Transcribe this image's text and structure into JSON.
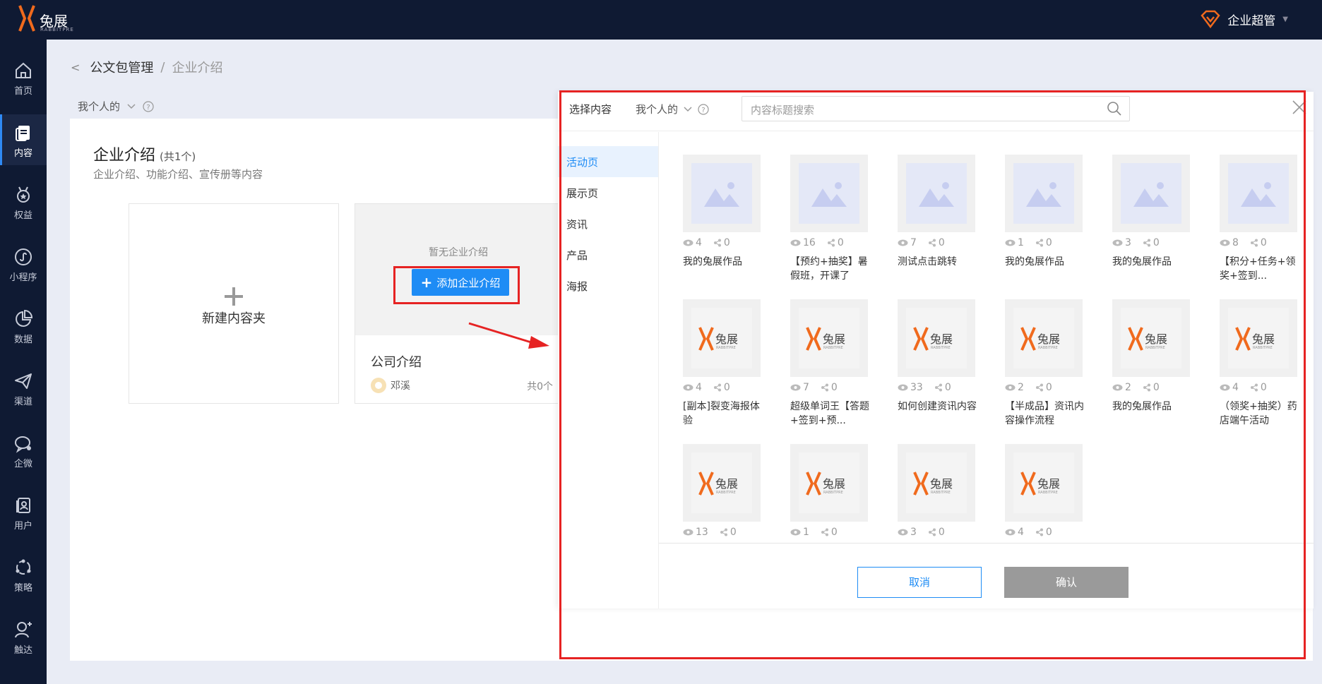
{
  "app": {
    "brand_name": "兔展",
    "brand_sub": "RABBITPRE",
    "admin_label": "企业超管"
  },
  "nav": [
    {
      "label": "首页",
      "icon": "home-icon"
    },
    {
      "label": "内容",
      "icon": "content-icon",
      "active": true
    },
    {
      "label": "权益",
      "icon": "badge-icon"
    },
    {
      "label": "小程序",
      "icon": "miniprogram-icon"
    },
    {
      "label": "数据",
      "icon": "pie-chart-icon"
    },
    {
      "label": "渠道",
      "icon": "send-icon"
    },
    {
      "label": "企微",
      "icon": "wecom-icon"
    },
    {
      "label": "用户",
      "icon": "user-card-icon"
    },
    {
      "label": "策略",
      "icon": "strategy-icon"
    },
    {
      "label": "触达",
      "icon": "reach-icon"
    }
  ],
  "breadcrumb": {
    "parent": "公文包管理",
    "separator": "/",
    "current": "企业介绍"
  },
  "filter": {
    "scope": "我个人的"
  },
  "section": {
    "title": "企业介绍",
    "count": "(共1个)",
    "subtitle": "企业介绍、功能介绍、宣传册等内容"
  },
  "new_folder": {
    "label": "新建内容夹"
  },
  "intro_card": {
    "empty_text": "暂无企业介绍",
    "add_label": "添加企业介绍",
    "name": "公司介绍",
    "author": "邓溪",
    "total": "共0个"
  },
  "modal": {
    "title": "选择内容",
    "scope": "我个人的",
    "search_placeholder": "内容标题搜索",
    "tabs": [
      "活动页",
      "展示页",
      "资讯",
      "产品",
      "海报"
    ],
    "active_tab": 0,
    "items": [
      {
        "type": "placeholder",
        "views": "4",
        "shares": "0",
        "title": "我的兔展作品"
      },
      {
        "type": "placeholder",
        "views": "16",
        "shares": "0",
        "title": "【预约+抽奖】暑假班，开课了"
      },
      {
        "type": "placeholder",
        "views": "7",
        "shares": "0",
        "title": "测试点击跳转"
      },
      {
        "type": "placeholder",
        "views": "1",
        "shares": "0",
        "title": "我的兔展作品"
      },
      {
        "type": "placeholder",
        "views": "3",
        "shares": "0",
        "title": "我的兔展作品"
      },
      {
        "type": "placeholder",
        "views": "8",
        "shares": "0",
        "title": "【积分+任务+领奖+签到..."
      },
      {
        "type": "brand",
        "views": "4",
        "shares": "0",
        "title": "[副本]裂变海报体验"
      },
      {
        "type": "brand",
        "views": "7",
        "shares": "0",
        "title": "超级单词王【答题+签到+预..."
      },
      {
        "type": "brand",
        "views": "33",
        "shares": "0",
        "title": "如何创建资讯内容"
      },
      {
        "type": "brand",
        "views": "2",
        "shares": "0",
        "title": "【半成品】资讯内容操作流程"
      },
      {
        "type": "brand",
        "views": "2",
        "shares": "0",
        "title": "我的兔展作品"
      },
      {
        "type": "brand",
        "views": "4",
        "shares": "0",
        "title": "（领奖+抽奖）药店端午活动"
      },
      {
        "type": "brand",
        "views": "13",
        "shares": "0",
        "title": ""
      },
      {
        "type": "brand",
        "views": "1",
        "shares": "0",
        "title": ""
      },
      {
        "type": "brand",
        "views": "3",
        "shares": "0",
        "title": ""
      },
      {
        "type": "brand",
        "views": "4",
        "shares": "0",
        "title": ""
      }
    ],
    "cancel_label": "取消",
    "ok_label": "确认"
  },
  "colors": {
    "topbar": "#0f1a33",
    "accent": "#1e8cf5",
    "highlight_red": "#e62323",
    "brand_orange": "#f06a1d"
  }
}
